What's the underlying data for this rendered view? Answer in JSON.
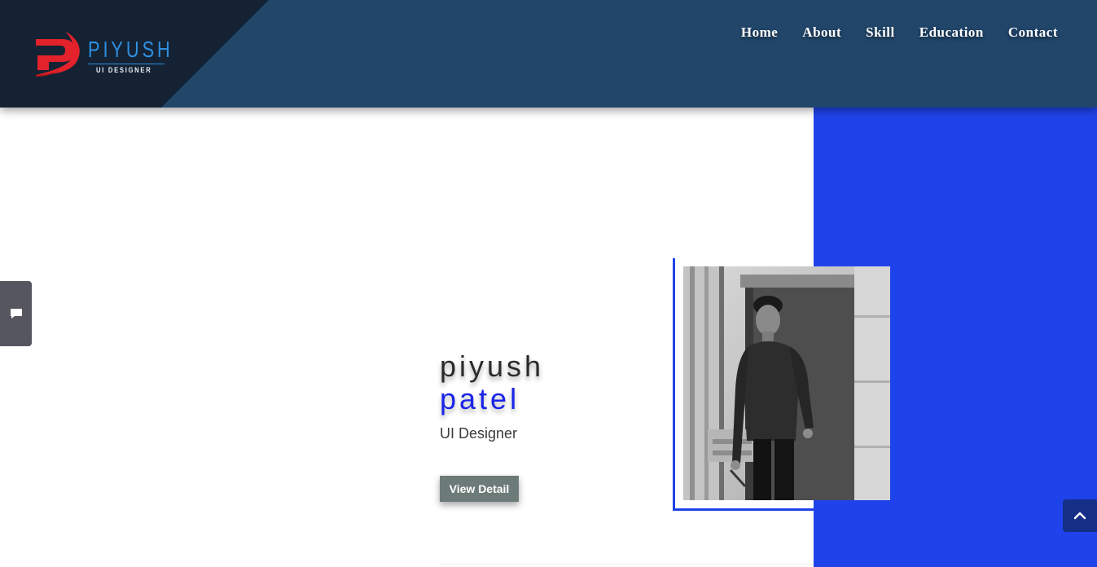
{
  "brand": {
    "name": "PIYUSH",
    "tagline": "UI DESIGNER",
    "logo_icon": "p-swoosh-logo-icon",
    "accent_red": "#e3222b",
    "accent_blue": "#2f8fe0"
  },
  "nav": {
    "items": [
      {
        "label": "Home"
      },
      {
        "label": "About"
      },
      {
        "label": "Skill"
      },
      {
        "label": "Education"
      },
      {
        "label": "Contact"
      }
    ]
  },
  "hero": {
    "first_name": "piyush",
    "last_name": "patel",
    "role": "UI Designer",
    "cta_label": "View Detail",
    "photo_icon": "profile-photo"
  },
  "widgets": {
    "chat_icon": "chat-bubble-icon",
    "scroll_top_icon": "chevron-up-icon"
  },
  "colors": {
    "navbar": "#21466a",
    "logo_panel": "#142233",
    "blue_panel": "#1f43ea",
    "last_name": "#1a24e6",
    "button": "#6d7b78",
    "chat_tab": "#55565f",
    "scroll_top": "#152e86"
  }
}
